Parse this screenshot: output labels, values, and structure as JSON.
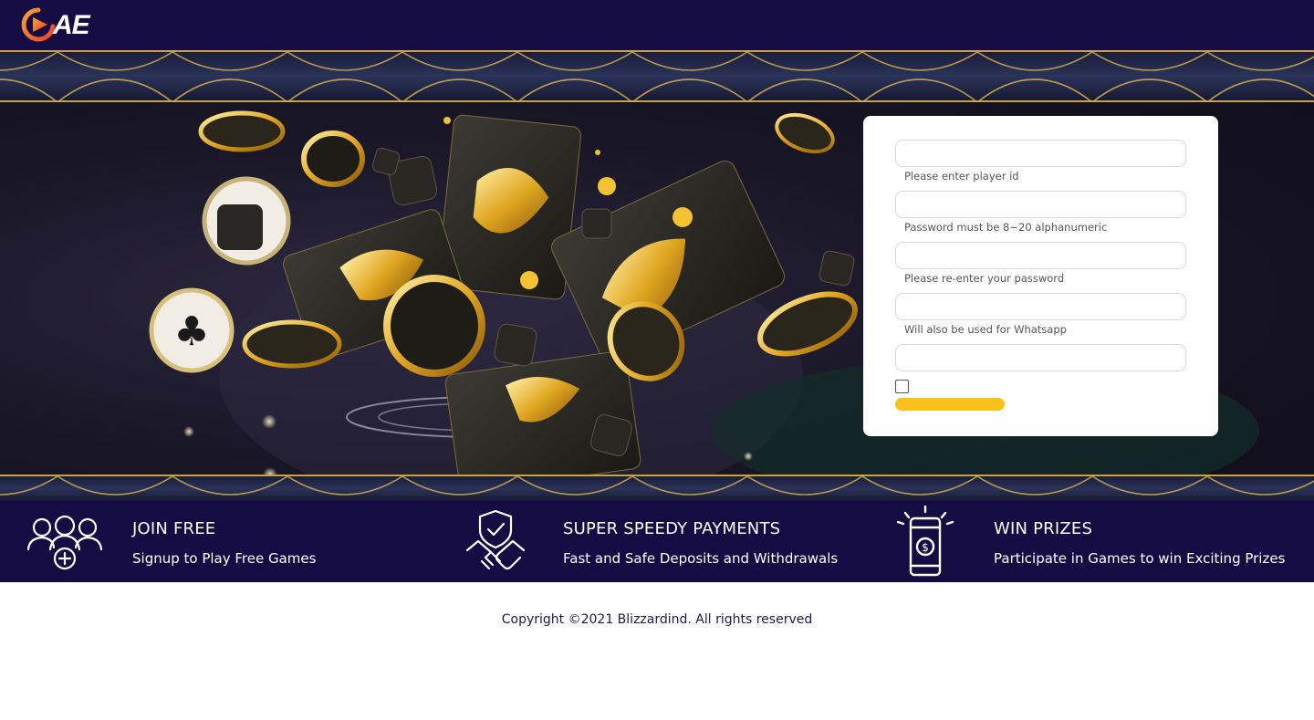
{
  "header": {
    "logo_text": "AE"
  },
  "signup_form": {
    "fields": [
      {
        "value": "",
        "hint": "Please enter player id"
      },
      {
        "value": "",
        "hint": "Password must be 8~20 alphanumeric"
      },
      {
        "value": "",
        "hint": "Please re-enter your password"
      },
      {
        "value": "",
        "hint": "Will also be used for Whatsapp"
      },
      {
        "value": ""
      }
    ],
    "checkbox_checked": false,
    "accent_color": "#f8c21a"
  },
  "features": [
    {
      "icon": "users-add-icon",
      "title": "JOIN FREE",
      "subtitle": "Signup to Play Free Games"
    },
    {
      "icon": "handshake-shield-icon",
      "title": "SUPER SPEEDY PAYMENTS",
      "subtitle": "Fast and Safe Deposits and Withdrawals"
    },
    {
      "icon": "phone-dollar-icon",
      "title": "WIN PRIZES",
      "subtitle": "Participate in Games to win Exciting Prizes"
    }
  ],
  "footer": {
    "copyright": "Copyright ©2021 Blizzardind. All rights reserved"
  },
  "colors": {
    "navy": "#140c42",
    "gold": "#c9a13e",
    "button_yellow": "#f8c21a"
  }
}
